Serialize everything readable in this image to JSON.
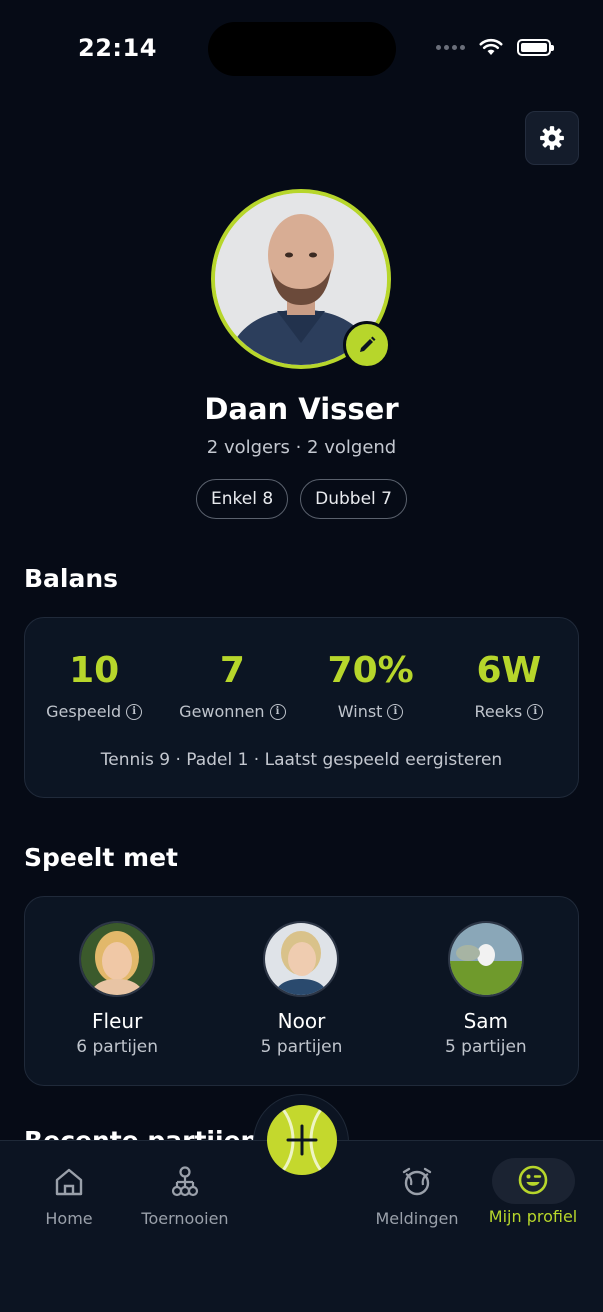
{
  "status_bar": {
    "time": "22:14"
  },
  "profile": {
    "name": "Daan Visser",
    "follow_line": "2 volgers · 2 volgend",
    "chips": [
      "Enkel 8",
      "Dubbel 7"
    ]
  },
  "balance": {
    "title": "Balans",
    "stats": [
      {
        "value": "10",
        "label": "Gespeeld"
      },
      {
        "value": "7",
        "label": "Gewonnen"
      },
      {
        "value": "70%",
        "label": "Winst"
      },
      {
        "value": "6W",
        "label": "Reeks"
      }
    ],
    "summary": "Tennis 9 · Padel 1 · Laatst gespeeld eergisteren"
  },
  "plays_with": {
    "title": "Speelt met",
    "players": [
      {
        "name": "Fleur",
        "count": "6 partijen"
      },
      {
        "name": "Noor",
        "count": "5 partijen"
      },
      {
        "name": "Sam",
        "count": "5 partijen"
      }
    ]
  },
  "next_section_title": "Recente partijen",
  "nav": {
    "items": [
      {
        "label": "Home",
        "icon": "home-icon"
      },
      {
        "label": "Toernooien",
        "icon": "tournament-icon"
      },
      {
        "label": "Meldingen",
        "icon": "notifications-icon"
      },
      {
        "label": "Mijn profiel",
        "icon": "smiley-icon"
      }
    ],
    "active": "Mijn profiel"
  },
  "colors": {
    "accent": "#b7d62b",
    "background": "#060b16",
    "card": "#0c1523"
  }
}
